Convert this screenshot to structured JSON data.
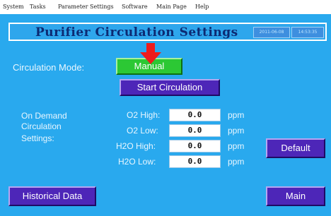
{
  "menu": [
    "System",
    "Tasks",
    "Parameter Settings",
    "Software",
    "Main Page",
    "Help"
  ],
  "title": "Purifier Circulation Settings",
  "date": "2011-06-08",
  "time": "14:53:35",
  "mode": {
    "label": "Circulation Mode:",
    "value": "Manual"
  },
  "start_button": "Start Circulation",
  "on_demand": {
    "label_line1": "On Demand",
    "label_line2": "Circulation",
    "label_line3": "Settings:",
    "rows": [
      {
        "label": "O2 High:",
        "value": "0.0",
        "unit": "ppm"
      },
      {
        "label": "O2 Low:",
        "value": "0.0",
        "unit": "ppm"
      },
      {
        "label": "H2O High:",
        "value": "0.0",
        "unit": "ppm"
      },
      {
        "label": "H2O Low:",
        "value": "0.0",
        "unit": "ppm"
      }
    ]
  },
  "buttons": {
    "default": "Default",
    "historical": "Historical Data",
    "main": "Main"
  },
  "colors": {
    "screen_bg": "#29a9ee",
    "title_text": "#0c2a73",
    "mode_button": "#2cc834",
    "action_button": "#4d26b8",
    "arrow": "#ee1c1c"
  },
  "icons": {
    "arrow": "red-down-arrow-icon"
  }
}
